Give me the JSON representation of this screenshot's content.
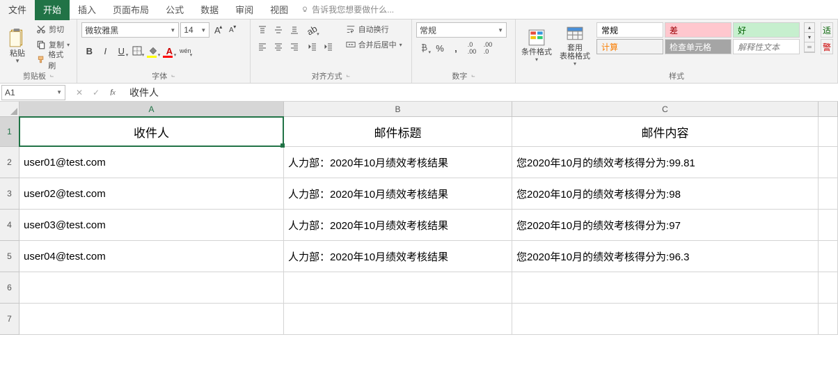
{
  "menu": {
    "file": "文件",
    "home": "开始",
    "insert": "插入",
    "page_layout": "页面布局",
    "formulas": "公式",
    "data": "数据",
    "review": "审阅",
    "view": "视图",
    "tell_me": "告诉我您想要做什么..."
  },
  "ribbon": {
    "clipboard": {
      "paste": "粘贴",
      "cut": "剪切",
      "copy": "复制",
      "format_painter": "格式刷",
      "label": "剪贴板"
    },
    "font": {
      "name": "微软雅黑",
      "size": "14",
      "bold": "B",
      "italic": "I",
      "underline": "U",
      "ruby": "wén",
      "label": "字体"
    },
    "alignment": {
      "wrap": "自动换行",
      "merge": "合并后居中",
      "label": "对齐方式"
    },
    "number": {
      "format": "常规",
      "label": "数字"
    },
    "styles": {
      "cond_fmt": "条件格式",
      "table_fmt": "套用\n表格格式",
      "s_normal": "常规",
      "s_bad": "差",
      "s_good": "好",
      "s_calc": "计算",
      "s_check": "检查单元格",
      "s_explain": "解释性文本",
      "s_warn": "警",
      "s_fit": "适",
      "label": "样式"
    }
  },
  "formula_bar": {
    "name_box": "A1",
    "fx_value": "收件人"
  },
  "grid": {
    "columns": [
      "A",
      "B",
      "C"
    ],
    "row_heights": {
      "header": 43,
      "body": 45,
      "empty": 45
    },
    "headers": [
      "收件人",
      "邮件标题",
      "邮件内容"
    ],
    "rows": [
      {
        "a": "user01@test.com",
        "b": "人力部：2020年10月绩效考核结果",
        "c": "您2020年10月的绩效考核得分为:99.81"
      },
      {
        "a": "user02@test.com",
        "b": "人力部：2020年10月绩效考核结果",
        "c": "您2020年10月的绩效考核得分为:98"
      },
      {
        "a": "user03@test.com",
        "b": "人力部：2020年10月绩效考核结果",
        "c": "您2020年10月的绩效考核得分为:97"
      },
      {
        "a": "user04@test.com",
        "b": "人力部：2020年10月绩效考核结果",
        "c": "您2020年10月的绩效考核得分为:96.3"
      }
    ],
    "selected_cell": "A1"
  }
}
